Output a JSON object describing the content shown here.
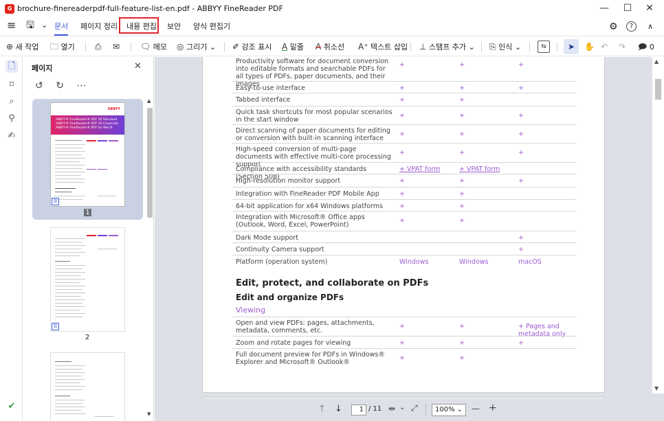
{
  "window": {
    "title": "brochure-finereaderpdf-full-feature-list-en.pdf - ABBYY FineReader PDF",
    "logo_text": "G",
    "minimize": "—",
    "maximize": "☐",
    "close": "✕"
  },
  "menu": {
    "hamburger": "≡",
    "save_icon": "🖫",
    "save_caret": "⌄",
    "items": [
      "문서",
      "페이지 정리",
      "내용 편집",
      "보안",
      "양식 편집기"
    ],
    "settings_icon": "⚙",
    "help_icon": "?",
    "collapse_icon": "∧",
    "highlighted_item": "내용 편집"
  },
  "toolbar": {
    "new_task": "새 작업",
    "open": "열기",
    "memo": "메모",
    "draw": "그리기",
    "highlight": "강조 표시",
    "underline": "밑줄",
    "strike": "취소선",
    "insert_text": "텍스트 삽입",
    "stamp": "스탬프 추가",
    "recognize": "인식",
    "comment_count": "0"
  },
  "panel": {
    "title": "페이지",
    "page_numbers": [
      "1",
      "2"
    ],
    "thumb1_header_lines": [
      "ABBYY® FineReader® PDF 16 Standard",
      "ABBYY® FineReader® PDF 16 Corporate",
      "ABBYY® FineReader® PDF for Mac®"
    ],
    "thumb1_brand": "ABBYY"
  },
  "document": {
    "rows": [
      {
        "feature": "Productivity software for document conversion into editable formats and searchable PDFs for all types of PDFs, paper documents, and their images",
        "a": "+",
        "b": "+",
        "c": "+"
      },
      {
        "feature": "Easy-to-use interface",
        "a": "+",
        "b": "+",
        "c": "+"
      },
      {
        "feature": "Tabbed interface",
        "a": "+",
        "b": "+",
        "c": ""
      },
      {
        "feature": "Quick task shortcuts for most popular scenarios in the start window",
        "a": "+",
        "b": "+",
        "c": "+"
      },
      {
        "feature": "Direct scanning of paper documents for editing or conversion with built-in scanning interface",
        "a": "+",
        "b": "+",
        "c": "+"
      },
      {
        "feature": "High-speed conversion of multi-page documents with effective multi-core processing support",
        "a": "+",
        "b": "+",
        "c": "+"
      },
      {
        "feature": "Compliance with accessibility standards (Section 508)",
        "a": "+ VPAT form",
        "b": "+ VPAT form",
        "c": ""
      },
      {
        "feature": "High-resolution monitor support",
        "a": "+",
        "b": "+",
        "c": "+"
      },
      {
        "feature": "Integration with FineReader PDF Mobile App",
        "a": "+",
        "b": "+",
        "c": ""
      },
      {
        "feature": "64-bit application for x64 Windows platforms",
        "a": "+",
        "b": "+",
        "c": ""
      },
      {
        "feature": "Integration with Microsoft® Office apps (Outlook, Word, Excel, PowerPoint)",
        "a": "+",
        "b": "+",
        "c": ""
      },
      {
        "feature": "Dark Mode support",
        "a": "",
        "b": "",
        "c": "+"
      },
      {
        "feature": "Continuity Camera support",
        "a": "",
        "b": "",
        "c": "+"
      },
      {
        "feature": "Platform (operation system)",
        "a": "Windows",
        "b": "Windows",
        "c": "macOS"
      }
    ],
    "heading1": "Edit, protect, and collaborate on PDFs",
    "heading2": "Edit and organize PDFs",
    "heading3": "Viewing",
    "rows2": [
      {
        "feature": "Open and view PDFs: pages, attachments, metadata, comments, etc.",
        "a": "+",
        "b": "+",
        "c": "+ Pages and metadata only"
      },
      {
        "feature": "Zoom and rotate pages for viewing",
        "a": "+",
        "b": "+",
        "c": "+"
      },
      {
        "feature": "Full document preview for PDFs in Windows® Explorer and Microsoft® Outlook®",
        "a": "+",
        "b": "+",
        "c": ""
      }
    ]
  },
  "nav": {
    "current_page": "1",
    "total_pages": "/ 11",
    "zoom": "100%",
    "minus": "—",
    "plus": "+"
  },
  "colors": {
    "accent": "#3b5bdb",
    "highlight_box": "#e0252b",
    "feature_mark": "#9b59d0",
    "canvas": "#dde0e6"
  }
}
